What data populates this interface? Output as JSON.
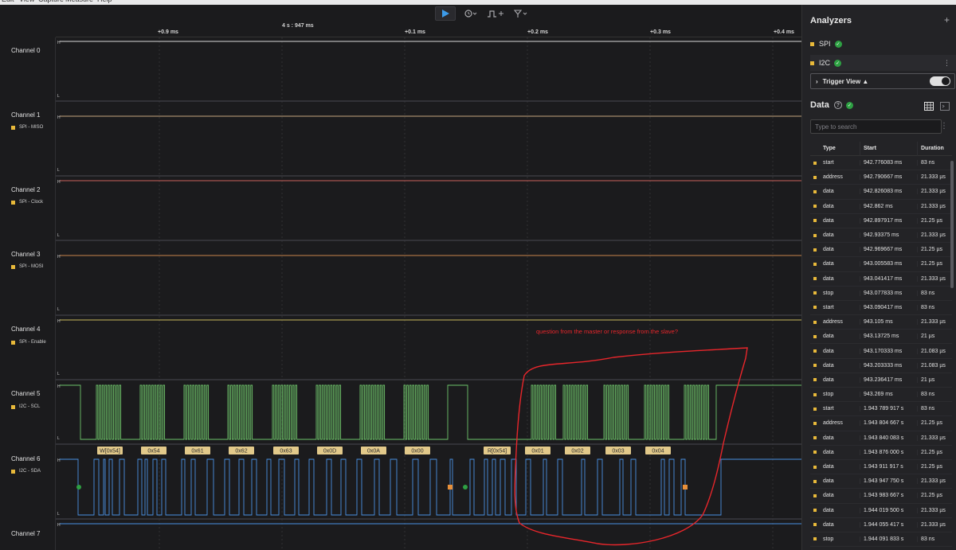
{
  "menu": [
    "Edit",
    "View",
    "Capture",
    "Measure",
    "Help"
  ],
  "ruler": {
    "center_label": "4 s : 947 ms",
    "ticks": [
      "+0.9 ms",
      "+0.1 ms",
      "+0.2 ms",
      "+0.3 ms",
      "+0.4 ms"
    ]
  },
  "channels": [
    {
      "name": "Channel 0",
      "sub": ""
    },
    {
      "name": "Channel 1",
      "sub": "SPI - MISO"
    },
    {
      "name": "Channel 2",
      "sub": "SPI - Clock"
    },
    {
      "name": "Channel 3",
      "sub": "SPI - MOSI"
    },
    {
      "name": "Channel 4",
      "sub": "SPI - Enable"
    },
    {
      "name": "Channel 5",
      "sub": "I2C - SCL"
    },
    {
      "name": "Channel 6",
      "sub": "I2C - SDA"
    },
    {
      "name": "Channel 7",
      "sub": ""
    }
  ],
  "level_labels": {
    "high": "H",
    "low": "L"
  },
  "decodes": [
    "W[0x54]",
    "0x54",
    "0x61",
    "0x62",
    "0x63",
    "0x0D",
    "0x0A",
    "0x00",
    "R[0x54]",
    "0x01",
    "0x02",
    "0x03",
    "0x04"
  ],
  "annotation": "question from the master or response from the slave?",
  "colors": {
    "scl": "#6ec46a",
    "sda": "#4a90e2",
    "accent": "#e8b93a",
    "annotation": "#e8262b"
  },
  "panel": {
    "title": "Analyzers",
    "analyzers": [
      "SPI",
      "I2C"
    ],
    "trigger_label": "Trigger View ▲",
    "data_title": "Data",
    "search_placeholder": "Type to search",
    "columns": [
      "Type",
      "Start",
      "Duration"
    ],
    "rows": [
      [
        "start",
        "942.776083 ms",
        "83 ns"
      ],
      [
        "address",
        "942.790667 ms",
        "21.333 µs"
      ],
      [
        "data",
        "942.826083 ms",
        "21.333 µs"
      ],
      [
        "data",
        "942.862 ms",
        "21.333 µs"
      ],
      [
        "data",
        "942.897917 ms",
        "21.25 µs"
      ],
      [
        "data",
        "942.93375 ms",
        "21.333 µs"
      ],
      [
        "data",
        "942.969667 ms",
        "21.25 µs"
      ],
      [
        "data",
        "943.005583 ms",
        "21.25 µs"
      ],
      [
        "data",
        "943.041417 ms",
        "21.333 µs"
      ],
      [
        "stop",
        "943.077833 ms",
        "83 ns"
      ],
      [
        "start",
        "943.090417 ms",
        "83 ns"
      ],
      [
        "address",
        "943.105 ms",
        "21.333 µs"
      ],
      [
        "data",
        "943.13725 ms",
        "21 µs"
      ],
      [
        "data",
        "943.170333 ms",
        "21.083 µs"
      ],
      [
        "data",
        "943.203333 ms",
        "21.083 µs"
      ],
      [
        "data",
        "943.236417 ms",
        "21 µs"
      ],
      [
        "stop",
        "943.269 ms",
        "83 ns"
      ],
      [
        "start",
        "1.943 789 917 s",
        "83 ns"
      ],
      [
        "address",
        "1.943 804 667 s",
        "21.25 µs"
      ],
      [
        "data",
        "1.943 840 083 s",
        "21.333 µs"
      ],
      [
        "data",
        "1.943 876 000 s",
        "21.25 µs"
      ],
      [
        "data",
        "1.943 911 917 s",
        "21.25 µs"
      ],
      [
        "data",
        "1.943 947 750 s",
        "21.333 µs"
      ],
      [
        "data",
        "1.943 983 667 s",
        "21.25 µs"
      ],
      [
        "data",
        "1.944 019 500 s",
        "21.333 µs"
      ],
      [
        "data",
        "1.944 055 417 s",
        "21.333 µs"
      ],
      [
        "stop",
        "1.944 091 833 s",
        "83 ns"
      ]
    ]
  }
}
